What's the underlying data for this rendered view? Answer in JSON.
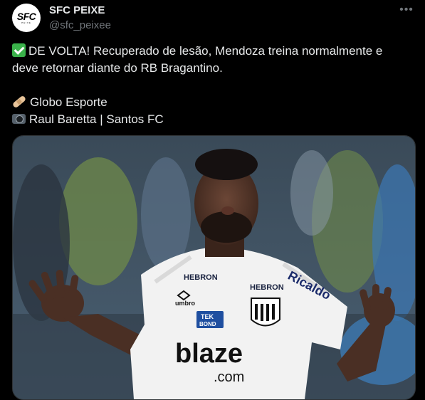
{
  "author": {
    "avatar_text": "SFC",
    "avatar_subtext": "PEIXE",
    "display_name": "SFC PEIXE",
    "handle": "@sfc_peixee"
  },
  "menu": {
    "icon": "more-horizontal-icon"
  },
  "tweet": {
    "line1": "DE VOLTA! Recuperado de lesão, Mendoza treina normalmente e",
    "line2": "deve retornar diante do RB Bragantino.",
    "line3": "Globo Esporte",
    "line4": "Raul Baretta | Santos FC",
    "emoji_1": "check-mark-emoji",
    "emoji_2": "adhesive-bandage-emoji",
    "emoji_3": "camera-emoji"
  },
  "photo": {
    "sponsor_left": "HEBRON",
    "sponsor_right": "HEBRON",
    "sleeve_sponsor": "Ricaldo",
    "brand": "umbro",
    "tek_label": "TEK",
    "bond_label": "BOND",
    "main_sponsor": "blaze",
    "main_sponsor_suffix": ".com"
  },
  "colors": {
    "background": "#000000",
    "text_primary": "#e7e9ea",
    "text_secondary": "#71767b"
  }
}
